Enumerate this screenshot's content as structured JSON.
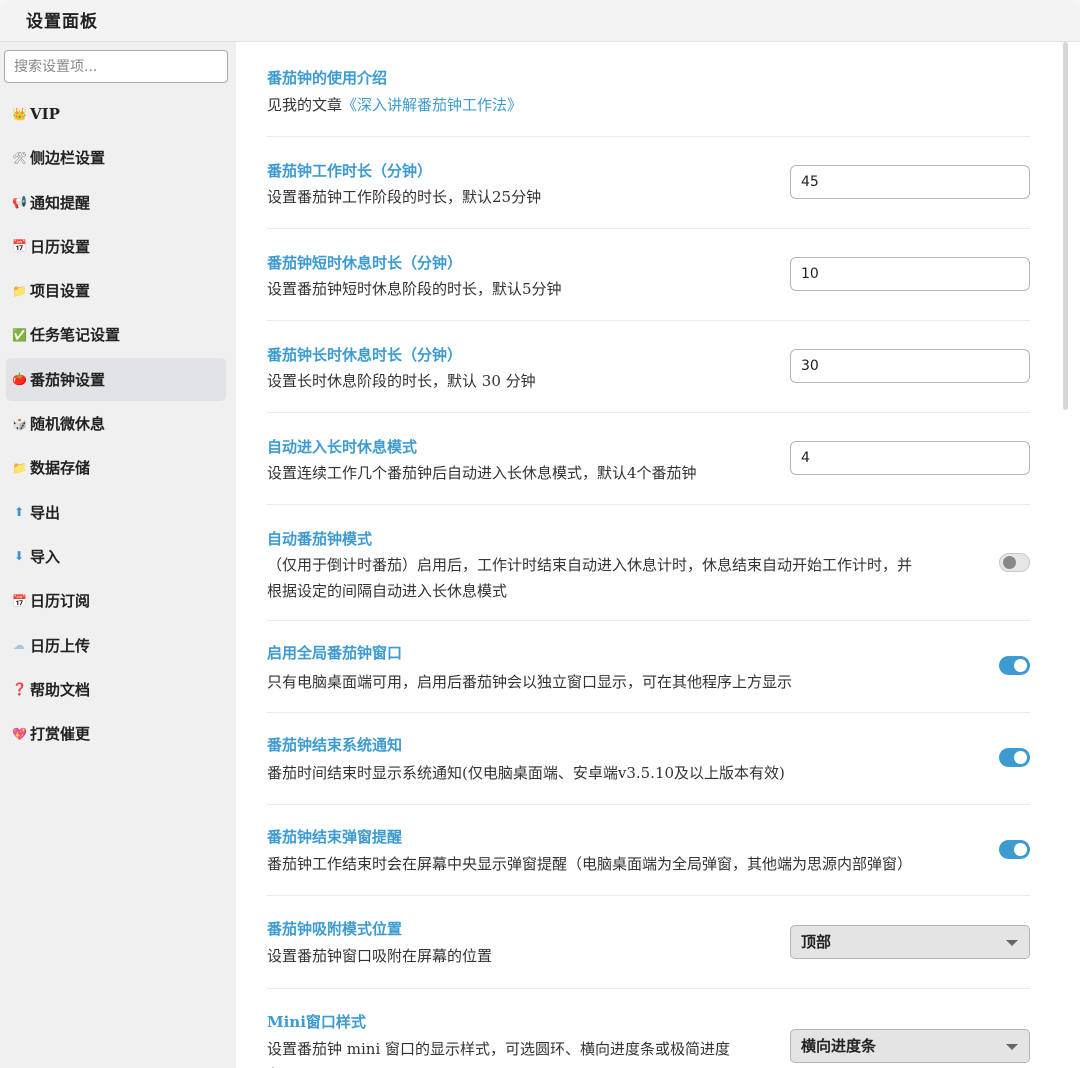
{
  "window": {
    "title": "设置面板"
  },
  "sidebar": {
    "search_placeholder": "搜索设置项...",
    "items": [
      {
        "label": "VIP",
        "icon": "crown-icon",
        "glyph": "👑",
        "color": "#d9a035"
      },
      {
        "label": "侧边栏设置",
        "icon": "tools-icon",
        "glyph": "🛠",
        "color": "#888888"
      },
      {
        "label": "通知提醒",
        "icon": "bell-icon",
        "glyph": "📢",
        "color": "#d94060"
      },
      {
        "label": "日历设置",
        "icon": "calendar-icon",
        "glyph": "📅",
        "color": "#5a7fb5"
      },
      {
        "label": "项目设置",
        "icon": "folder-icon",
        "glyph": "📁",
        "color": "#e8b730"
      },
      {
        "label": "任务笔记设置",
        "icon": "checkbox-icon",
        "glyph": "✅",
        "color": "#3fae4a"
      },
      {
        "label": "番茄钟设置",
        "icon": "tomato-icon",
        "glyph": "🍅",
        "color": "#d84a3a",
        "active": true
      },
      {
        "label": "随机微休息",
        "icon": "dice-icon",
        "glyph": "🎲",
        "color": "#7a6fb0"
      },
      {
        "label": "数据存储",
        "icon": "folder-icon",
        "glyph": "📁",
        "color": "#e8b730"
      },
      {
        "label": "导出",
        "icon": "arrow-up-icon",
        "glyph": "⬆",
        "color": "#3d8fd6"
      },
      {
        "label": "导入",
        "icon": "arrow-down-icon",
        "glyph": "⬇",
        "color": "#3d8fd6"
      },
      {
        "label": "日历订阅",
        "icon": "calendar-icon",
        "glyph": "📅",
        "color": "#5a7fb5"
      },
      {
        "label": "日历上传",
        "icon": "cloud-icon",
        "glyph": "☁",
        "color": "#a8c8e8"
      },
      {
        "label": "帮助文档",
        "icon": "question-icon",
        "glyph": "❓",
        "color": "#d23a3a"
      },
      {
        "label": "打赏催更",
        "icon": "heart-icon",
        "glyph": "💖",
        "color": "#e23c6a"
      }
    ]
  },
  "settings": {
    "intro": {
      "title": "番茄钟的使用介绍",
      "desc_prefix": "见我的文章",
      "link": "《深入讲解番茄钟工作法》"
    },
    "work_duration": {
      "title": "番茄钟工作时长（分钟）",
      "desc": "设置番茄钟工作阶段的时长，默认25分钟",
      "value": "45"
    },
    "short_break": {
      "title": "番茄钟短时休息时长（分钟）",
      "desc": "设置番茄钟短时休息阶段的时长，默认5分钟",
      "value": "10"
    },
    "long_break": {
      "title": "番茄钟长时休息时长（分钟）",
      "desc": "设置长时休息阶段的时长，默认 30 分钟",
      "value": "30"
    },
    "auto_long_break": {
      "title": "自动进入长时休息模式",
      "desc": "设置连续工作几个番茄钟后自动进入长休息模式，默认4个番茄钟",
      "value": "4"
    },
    "auto_mode": {
      "title": "自动番茄钟模式",
      "desc_line1": "（仅用于倒计时番茄）启用后，工作计时结束自动进入休息计时，休息结束自动开始工作计时，并",
      "desc_line2": "根据设定的间隔自动进入长休息模式",
      "enabled": false
    },
    "global_window": {
      "title": "启用全局番茄钟窗口",
      "desc": "只有电脑桌面端可用，启用后番茄钟会以独立窗口显示，可在其他程序上方显示",
      "enabled": true
    },
    "system_notify": {
      "title": "番茄钟结束系统通知",
      "desc": "番茄时间结束时显示系统通知(仅电脑桌面端、安卓端v3.5.10及以上版本有效)",
      "enabled": true
    },
    "popup_notify": {
      "title": "番茄钟结束弹窗提醒",
      "desc": "番茄钟工作结束时会在屏幕中央显示弹窗提醒（电脑桌面端为全局弹窗，其他端为思源内部弹窗）",
      "enabled": true
    },
    "dock_position": {
      "title": "番茄钟吸附模式位置",
      "desc": "设置番茄钟窗口吸附在屏幕的位置",
      "selected": "顶部"
    },
    "mini_style": {
      "title": "Mini窗口样式",
      "desc_line1": "设置番茄钟 mini 窗口的显示样式，可选圆环、横向进度条或极简进度",
      "desc_line2": "条",
      "selected": "横向进度条"
    }
  },
  "colors": {
    "accent": "#3d9bd1",
    "active_bg": "#e1e3e6"
  }
}
